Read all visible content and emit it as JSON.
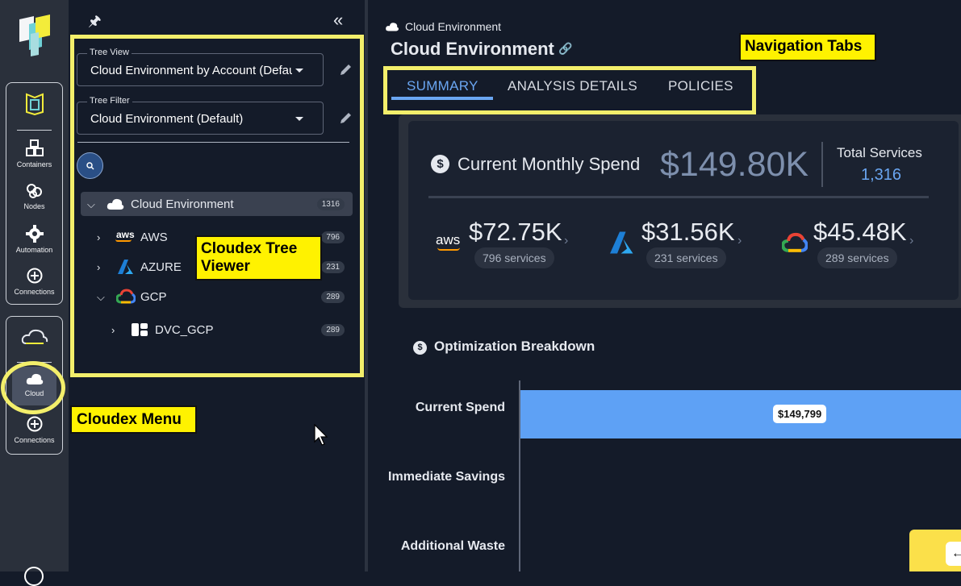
{
  "rail": {
    "items_top": [
      {
        "label": "Containers",
        "icon": "cubes-icon"
      },
      {
        "label": "Nodes",
        "icon": "nodes-icon"
      },
      {
        "label": "Automation",
        "icon": "gear-icon"
      },
      {
        "label": "Connections",
        "icon": "plus-circle-icon"
      }
    ],
    "items_bottom": [
      {
        "label": "Cloud",
        "icon": "cloud-icon"
      },
      {
        "label": "Connections",
        "icon": "plus-circle-icon"
      }
    ]
  },
  "tree_panel": {
    "tree_view": {
      "label": "Tree View",
      "value": "Cloud Environment by Account (Default)"
    },
    "tree_filter": {
      "label": "Tree Filter",
      "value": "Cloud Environment (Default)"
    },
    "nodes": [
      {
        "label": "Cloud Environment",
        "count": "1316"
      },
      {
        "label": "AWS",
        "count": "796"
      },
      {
        "label": "AZURE",
        "count": "231"
      },
      {
        "label": "GCP",
        "count": "289"
      },
      {
        "label": "DVC_GCP",
        "count": "289"
      }
    ]
  },
  "annotations": {
    "tree_viewer": "Cloudex Tree Viewer",
    "menu": "Cloudex Menu",
    "nav_tabs": "Navigation Tabs"
  },
  "main": {
    "breadcrumb": "Cloud Environment",
    "title": "Cloud Environment",
    "tabs": [
      {
        "label": "SUMMARY",
        "active": true
      },
      {
        "label": "ANALYSIS DETAILS",
        "active": false
      },
      {
        "label": "POLICIES",
        "active": false
      }
    ],
    "spend": {
      "label": "Current Monthly Spend",
      "value": "$149.80K",
      "total_services_label": "Total Services",
      "total_services_value": "1,316"
    },
    "providers": [
      {
        "name": "aws",
        "amount": "$72.75K",
        "services": "796 services"
      },
      {
        "name": "azure",
        "amount": "$31.56K",
        "services": "231 services"
      },
      {
        "name": "gcp",
        "amount": "$45.48K",
        "services": "289 services"
      }
    ],
    "optimization": {
      "title": "Optimization Breakdown",
      "categories": [
        "Current Spend",
        "Immediate Savings",
        "Additional Waste"
      ],
      "bar_label": "$149,799"
    }
  },
  "colors": {
    "accent": "#6aa6f2",
    "bar": "#5ea1f5",
    "annotation": "#fff200"
  }
}
